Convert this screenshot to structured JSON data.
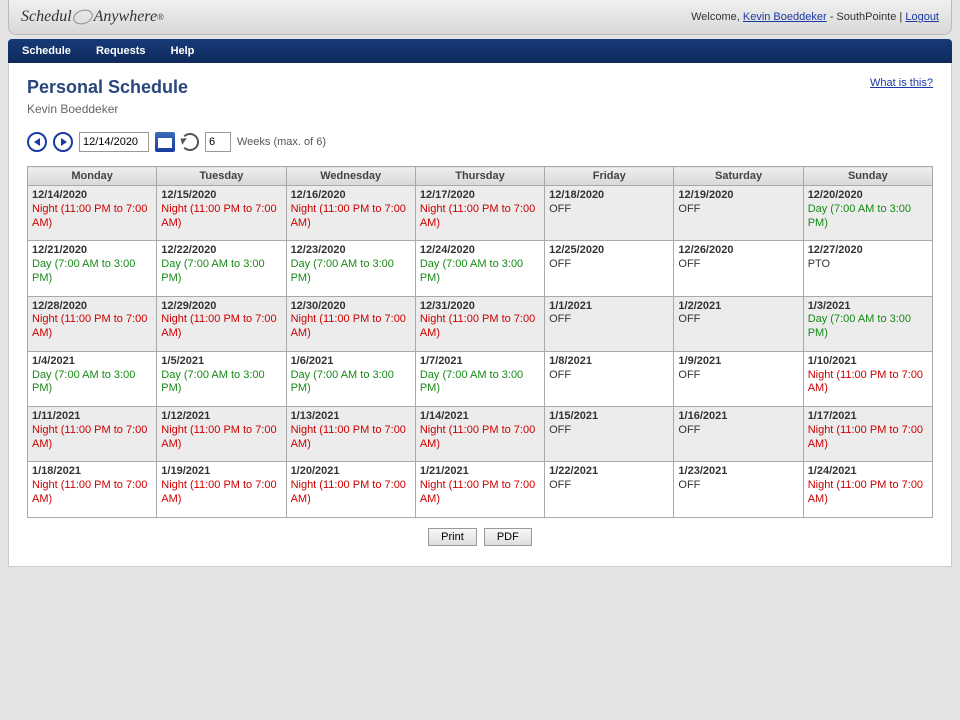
{
  "header": {
    "logo_pre": "Schedul",
    "logo_post": "Anywhere",
    "welcome_prefix": "Welcome, ",
    "user_name": "Kevin Boeddeker",
    "location_sep": " - ",
    "location": "SouthPointe",
    "pipe": " | ",
    "logout": "Logout"
  },
  "nav": {
    "schedule": "Schedule",
    "requests": "Requests",
    "help": "Help"
  },
  "title": "Personal Schedule",
  "subtitle": "Kevin Boeddeker",
  "whatis": "What is this?",
  "toolbar": {
    "date": "12/14/2020",
    "weeks_value": "6",
    "weeks_label": "Weeks (max. of 6)"
  },
  "day_headers": [
    "Monday",
    "Tuesday",
    "Wednesday",
    "Thursday",
    "Friday",
    "Saturday",
    "Sunday"
  ],
  "shift_labels": {
    "night": "Night (11:00 PM to 7:00 AM)",
    "day": "Day (7:00 AM to 3:00 PM)",
    "off": "OFF",
    "pto": "PTO"
  },
  "weeks": [
    [
      {
        "date": "12/14/2020",
        "shift": "night",
        "alt": true
      },
      {
        "date": "12/15/2020",
        "shift": "night",
        "alt": true
      },
      {
        "date": "12/16/2020",
        "shift": "night",
        "alt": true
      },
      {
        "date": "12/17/2020",
        "shift": "night",
        "alt": true
      },
      {
        "date": "12/18/2020",
        "shift": "off",
        "alt": true
      },
      {
        "date": "12/19/2020",
        "shift": "off",
        "alt": true
      },
      {
        "date": "12/20/2020",
        "shift": "day",
        "alt": true
      }
    ],
    [
      {
        "date": "12/21/2020",
        "shift": "day"
      },
      {
        "date": "12/22/2020",
        "shift": "day"
      },
      {
        "date": "12/23/2020",
        "shift": "day"
      },
      {
        "date": "12/24/2020",
        "shift": "day"
      },
      {
        "date": "12/25/2020",
        "shift": "off"
      },
      {
        "date": "12/26/2020",
        "shift": "off"
      },
      {
        "date": "12/27/2020",
        "shift": "pto"
      }
    ],
    [
      {
        "date": "12/28/2020",
        "shift": "night",
        "alt": true
      },
      {
        "date": "12/29/2020",
        "shift": "night",
        "alt": true
      },
      {
        "date": "12/30/2020",
        "shift": "night",
        "alt": true
      },
      {
        "date": "12/31/2020",
        "shift": "night",
        "alt": true
      },
      {
        "date": "1/1/2021",
        "shift": "off",
        "alt": true
      },
      {
        "date": "1/2/2021",
        "shift": "off",
        "alt": true
      },
      {
        "date": "1/3/2021",
        "shift": "day",
        "alt": true
      }
    ],
    [
      {
        "date": "1/4/2021",
        "shift": "day"
      },
      {
        "date": "1/5/2021",
        "shift": "day"
      },
      {
        "date": "1/6/2021",
        "shift": "day"
      },
      {
        "date": "1/7/2021",
        "shift": "day"
      },
      {
        "date": "1/8/2021",
        "shift": "off"
      },
      {
        "date": "1/9/2021",
        "shift": "off"
      },
      {
        "date": "1/10/2021",
        "shift": "night"
      }
    ],
    [
      {
        "date": "1/11/2021",
        "shift": "night",
        "alt": true
      },
      {
        "date": "1/12/2021",
        "shift": "night",
        "alt": true
      },
      {
        "date": "1/13/2021",
        "shift": "night",
        "alt": true
      },
      {
        "date": "1/14/2021",
        "shift": "night",
        "alt": true
      },
      {
        "date": "1/15/2021",
        "shift": "off",
        "alt": true
      },
      {
        "date": "1/16/2021",
        "shift": "off",
        "alt": true
      },
      {
        "date": "1/17/2021",
        "shift": "night",
        "alt": true
      }
    ],
    [
      {
        "date": "1/18/2021",
        "shift": "night"
      },
      {
        "date": "1/19/2021",
        "shift": "night"
      },
      {
        "date": "1/20/2021",
        "shift": "night"
      },
      {
        "date": "1/21/2021",
        "shift": "night"
      },
      {
        "date": "1/22/2021",
        "shift": "off"
      },
      {
        "date": "1/23/2021",
        "shift": "off"
      },
      {
        "date": "1/24/2021",
        "shift": "night"
      }
    ]
  ],
  "actions": {
    "print": "Print",
    "pdf": "PDF"
  }
}
